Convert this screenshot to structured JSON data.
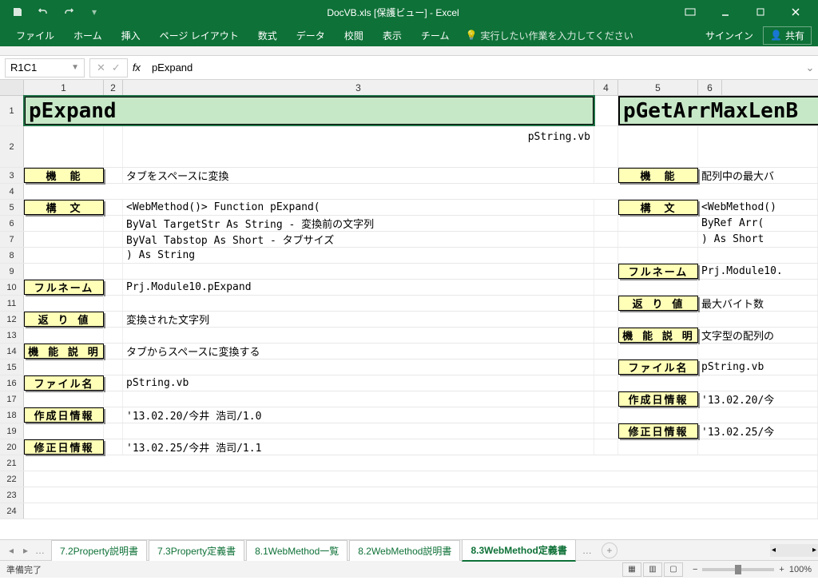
{
  "title": "DocVB.xls  [保護ビュー] - Excel",
  "qat": {
    "save": "save",
    "undo": "undo",
    "redo": "redo"
  },
  "ribbon": {
    "tabs": [
      "ファイル",
      "ホーム",
      "挿入",
      "ページ レイアウト",
      "数式",
      "データ",
      "校閲",
      "表示",
      "チーム"
    ],
    "tellme": "実行したい作業を入力してください",
    "signin": "サインイン",
    "share": "共有"
  },
  "namebox": "R1C1",
  "formula": "pExpand",
  "cols": [
    "1",
    "2",
    "3",
    "4",
    "5",
    "6"
  ],
  "left": {
    "header": "pExpand",
    "subheader": "pString.vb",
    "rows": {
      "kinou_label": "機　能",
      "kinou": "タブをスペースに変換",
      "koubun_label": "構　文",
      "koubun1": "<WebMethod()> Function pExpand(",
      "koubun2": "  ByVal TargetStr  As String - 変換前の文字列",
      "koubun3": "  ByVal Tabstop    As Short  - タブサイズ",
      "koubun4": ") As String",
      "fullname_label": "フルネーム",
      "fullname": "Prj.Module10.pExpand",
      "return_label": "返 り 値",
      "return": "変換された文字列",
      "desc_label": "機 能 説 明",
      "desc": "タブからスペースに変換する",
      "file_label": "ファイル名",
      "file": "pString.vb",
      "created_label": "作成日情報",
      "created": "'13.02.20/今井 浩司/1.0",
      "modified_label": "修正日情報",
      "modified": "'13.02.25/今井 浩司/1.1"
    }
  },
  "right": {
    "header": "pGetArrMaxLenB",
    "rows": {
      "kinou_label": "機　能",
      "kinou": "配列中の最大バ",
      "koubun_label": "構　文",
      "koubun1": "<WebMethod()",
      "koubun2": "  ByRef Arr(",
      "koubun3": ") As Short",
      "fullname_label": "フルネーム",
      "fullname": "Prj.Module10.",
      "return_label": "返 り 値",
      "return": "最大バイト数",
      "desc_label": "機 能 説 明",
      "desc": "文字型の配列の",
      "file_label": "ファイル名",
      "file": "pString.vb",
      "created_label": "作成日情報",
      "created": "'13.02.20/今",
      "modified_label": "修正日情報",
      "modified": "'13.02.25/今"
    }
  },
  "sheets": [
    "7.2Property説明書",
    "7.3Property定義書",
    "8.1WebMethod一覧",
    "8.2WebMethod説明書",
    "8.3WebMethod定義書"
  ],
  "active_sheet": 4,
  "status": "準備完了",
  "zoom": "100%"
}
